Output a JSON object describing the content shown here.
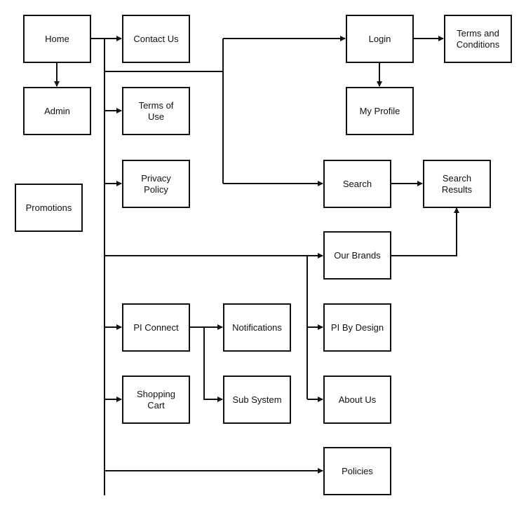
{
  "diagram": {
    "title": "",
    "colors": {
      "stroke": "#111111",
      "background": "#ffffff",
      "text": "#111111"
    },
    "nodes": {
      "home": "Home",
      "contact_us": "Contact Us",
      "admin": "Admin",
      "terms_of_use": "Terms of\nUse",
      "privacy_policy": "Privacy\nPolicy",
      "promotions": "Promotions",
      "login": "Login",
      "terms_and_conditions": "Terms and\nConditions",
      "my_profile": "My Profile",
      "search": "Search",
      "search_results": "Search\nResults",
      "our_brands": "Our Brands",
      "pi_connect": "PI Connect",
      "notifications": "Notifications",
      "shopping_cart": "Shopping\nCart",
      "sub_system": "Sub System",
      "pi_by_design": "PI By Design",
      "about_us": "About Us",
      "policies": "Policies"
    },
    "edges": [
      [
        "home",
        "contact_us"
      ],
      [
        "home",
        "admin"
      ],
      [
        "home",
        "terms_of_use"
      ],
      [
        "home",
        "privacy_policy"
      ],
      [
        "home",
        "login"
      ],
      [
        "home",
        "search"
      ],
      [
        "home",
        "our_brands"
      ],
      [
        "home",
        "pi_connect"
      ],
      [
        "home",
        "shopping_cart"
      ],
      [
        "home",
        "policies"
      ],
      [
        "home",
        "pi_by_design"
      ],
      [
        "home",
        "about_us"
      ],
      [
        "login",
        "terms_and_conditions"
      ],
      [
        "login",
        "my_profile"
      ],
      [
        "search",
        "search_results"
      ],
      [
        "our_brands",
        "search_results"
      ],
      [
        "pi_connect",
        "notifications"
      ],
      [
        "pi_connect",
        "sub_system"
      ]
    ]
  }
}
